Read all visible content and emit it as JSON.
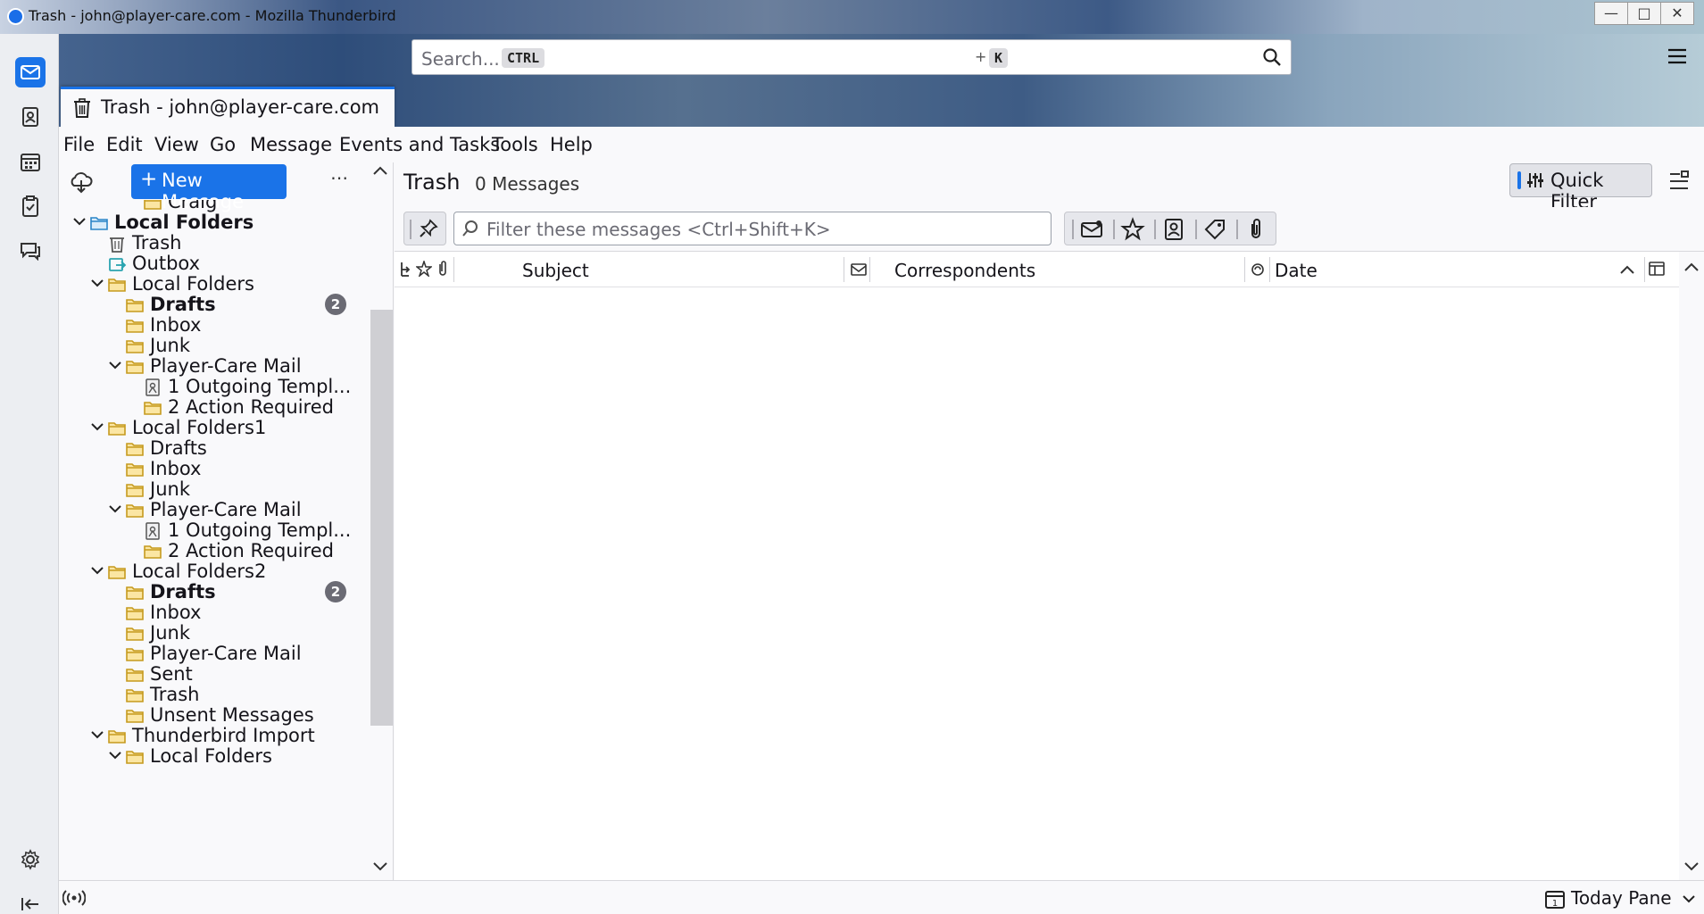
{
  "window": {
    "title": "Trash - john@player-care.com - Mozilla Thunderbird"
  },
  "search": {
    "placeholder": "Search...",
    "shortcut_key1": "CTRL",
    "shortcut_plus": "+",
    "shortcut_key2": "K"
  },
  "tab": {
    "title": "Trash - john@player-care.com"
  },
  "menubar": {
    "items": [
      "File",
      "Edit",
      "View",
      "Go",
      "Message",
      "Events and Tasks",
      "Tools",
      "Help"
    ]
  },
  "folder_pane": {
    "new_message_label": "New Message",
    "more_label": "⋯",
    "folders": [
      {
        "name": "Craig",
        "bold": false,
        "unread": null,
        "icon": "folder",
        "twisty": null
      },
      {
        "name": "Local Folders",
        "bold": true,
        "unread": null,
        "icon": "account-folder",
        "twisty": "open"
      },
      {
        "name": "Trash",
        "bold": false,
        "unread": null,
        "icon": "trash",
        "twisty": null
      },
      {
        "name": "Outbox",
        "bold": false,
        "unread": null,
        "icon": "outbox",
        "twisty": null
      },
      {
        "name": "Local Folders",
        "bold": false,
        "unread": null,
        "icon": "folder",
        "twisty": "open"
      },
      {
        "name": "Drafts",
        "bold": true,
        "unread": "2",
        "icon": "folder",
        "twisty": null
      },
      {
        "name": "Inbox",
        "bold": false,
        "unread": null,
        "icon": "folder",
        "twisty": null
      },
      {
        "name": "Junk",
        "bold": false,
        "unread": null,
        "icon": "folder",
        "twisty": null
      },
      {
        "name": "Player-Care Mail",
        "bold": false,
        "unread": null,
        "icon": "folder",
        "twisty": "open"
      },
      {
        "name": "1 Outgoing Templ...",
        "bold": false,
        "unread": null,
        "icon": "template",
        "twisty": null
      },
      {
        "name": "2 Action Required",
        "bold": false,
        "unread": null,
        "icon": "folder",
        "twisty": null
      },
      {
        "name": "Local Folders1",
        "bold": false,
        "unread": null,
        "icon": "folder",
        "twisty": "open"
      },
      {
        "name": "Drafts",
        "bold": false,
        "unread": null,
        "icon": "folder",
        "twisty": null
      },
      {
        "name": "Inbox",
        "bold": false,
        "unread": null,
        "icon": "folder",
        "twisty": null
      },
      {
        "name": "Junk",
        "bold": false,
        "unread": null,
        "icon": "folder",
        "twisty": null
      },
      {
        "name": "Player-Care Mail",
        "bold": false,
        "unread": null,
        "icon": "folder",
        "twisty": "open"
      },
      {
        "name": "1 Outgoing Templ...",
        "bold": false,
        "unread": null,
        "icon": "template",
        "twisty": null
      },
      {
        "name": "2 Action Required",
        "bold": false,
        "unread": null,
        "icon": "folder",
        "twisty": null
      },
      {
        "name": "Local Folders2",
        "bold": false,
        "unread": null,
        "icon": "folder",
        "twisty": "open"
      },
      {
        "name": "Drafts",
        "bold": true,
        "unread": "2",
        "icon": "folder",
        "twisty": null
      },
      {
        "name": "Inbox",
        "bold": false,
        "unread": null,
        "icon": "folder",
        "twisty": null
      },
      {
        "name": "Junk",
        "bold": false,
        "unread": null,
        "icon": "folder",
        "twisty": null
      },
      {
        "name": "Player-Care Mail",
        "bold": false,
        "unread": null,
        "icon": "folder",
        "twisty": null
      },
      {
        "name": "Sent",
        "bold": false,
        "unread": null,
        "icon": "folder",
        "twisty": null
      },
      {
        "name": "Trash",
        "bold": false,
        "unread": null,
        "icon": "folder",
        "twisty": null
      },
      {
        "name": "Unsent Messages",
        "bold": false,
        "unread": null,
        "icon": "folder",
        "twisty": null
      },
      {
        "name": "Thunderbird Import",
        "bold": false,
        "unread": null,
        "icon": "folder",
        "twisty": "open"
      },
      {
        "name": "Local Folders",
        "bold": false,
        "unread": null,
        "icon": "folder",
        "twisty": "open"
      }
    ]
  },
  "thread_pane": {
    "folder_name": "Trash",
    "message_count": "0 Messages",
    "quick_filter_label": "Quick Filter",
    "filter_placeholder": "Filter these messages <Ctrl+Shift+K>",
    "columns": {
      "subject": "Subject",
      "correspondents": "Correspondents",
      "date": "Date"
    }
  },
  "statusbar": {
    "today_pane_label": "Today Pane"
  },
  "colors": {
    "accent": "#1a73e8",
    "folder_icon": "#e8b63c",
    "badge": "#6b6b74"
  }
}
